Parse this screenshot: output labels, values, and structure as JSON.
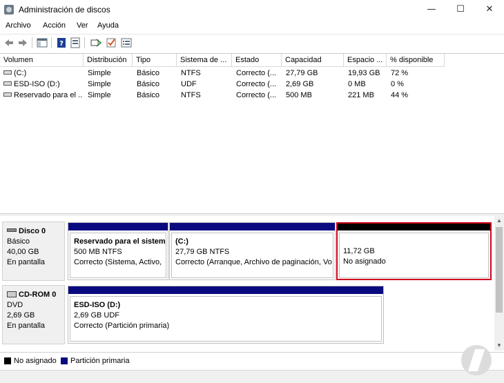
{
  "window": {
    "title": "Administración de discos"
  },
  "window_controls": {
    "minimize": "—",
    "maximize": "☐",
    "close": "✕"
  },
  "menu": [
    "Archivo",
    "Acción",
    "Ver",
    "Ayuda"
  ],
  "toolbar_icons": [
    "back-arrow-icon",
    "forward-arrow-icon",
    "console-tree-icon",
    "help-icon",
    "properties-icon",
    "rescan-icon",
    "checkmark-icon",
    "list-view-icon"
  ],
  "volume_table": {
    "columns": [
      "Volumen",
      "Distribución",
      "Tipo",
      "Sistema de ...",
      "Estado",
      "Capacidad",
      "Espacio ...",
      "% disponible"
    ],
    "rows": [
      [
        "(C:)",
        "Simple",
        "Básico",
        "NTFS",
        "Correcto (...",
        "27,79 GB",
        "19,93 GB",
        "72 %"
      ],
      [
        "ESD-ISO (D:)",
        "Simple",
        "Básico",
        "UDF",
        "Correcto (...",
        "2,69 GB",
        "0 MB",
        "0 %"
      ],
      [
        "Reservado para el ...",
        "Simple",
        "Básico",
        "NTFS",
        "Correcto (...",
        "500 MB",
        "221 MB",
        "44 %"
      ]
    ]
  },
  "disks": [
    {
      "name": "Disco 0",
      "type": "Básico",
      "size": "40,00 GB",
      "status": "En pantalla",
      "partitions": [
        {
          "name": "Reservado para el sistema",
          "size": "500 MB NTFS",
          "status": "Correcto (Sistema, Activo, ",
          "kind": "primary"
        },
        {
          "name": "(C:)",
          "size": "27,79 GB NTFS",
          "status": "Correcto (Arranque, Archivo de paginación, Vo",
          "kind": "primary"
        },
        {
          "name": "",
          "size": "11,72 GB",
          "status": "No asignado",
          "kind": "unallocated"
        }
      ]
    },
    {
      "name": "CD-ROM 0",
      "type": "DVD",
      "size": "2,69 GB",
      "status": "En pantalla",
      "partitions": [
        {
          "name": "ESD-ISO  (D:)",
          "size": "2,69 GB UDF",
          "status": "Correcto (Partición primaria)",
          "kind": "primary"
        }
      ]
    }
  ],
  "legend": [
    {
      "label": "No asignado",
      "color": "#000000"
    },
    {
      "label": "Partición primaria",
      "color": "#0a0a80"
    }
  ],
  "colors": {
    "primary_partition": "#0a0a80",
    "unallocated": "#000000",
    "highlight": "#d0021b"
  }
}
